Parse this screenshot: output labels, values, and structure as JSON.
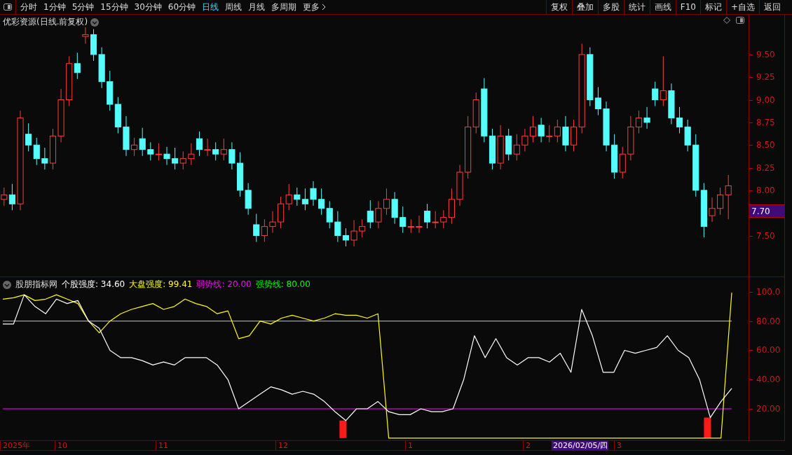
{
  "periods": [
    {
      "label": "分时",
      "selected": false
    },
    {
      "label": "1分钟",
      "selected": false
    },
    {
      "label": "5分钟",
      "selected": false
    },
    {
      "label": "15分钟",
      "selected": false
    },
    {
      "label": "30分钟",
      "selected": false
    },
    {
      "label": "60分钟",
      "selected": false
    },
    {
      "label": "日线",
      "selected": true
    },
    {
      "label": "周线",
      "selected": false
    },
    {
      "label": "月线",
      "selected": false
    },
    {
      "label": "多周期",
      "selected": false
    },
    {
      "label": "更多",
      "selected": false
    }
  ],
  "toolbar_buttons": [
    "复权",
    "叠加",
    "多股",
    "统计",
    "画线",
    "F10",
    "标记",
    "+自选",
    "返回"
  ],
  "price_panel": {
    "title": "优彩资源(日线.前复权)",
    "current_price": "7.70",
    "chart_data": {
      "type": "candlestick",
      "ylim": [
        7.04,
        9.94
      ],
      "yticks": [
        {
          "value": 9.5,
          "label": "9.50"
        },
        {
          "value": 9.25,
          "label": "9.25"
        },
        {
          "value": 9.0,
          "label": "9.00"
        },
        {
          "value": 8.75,
          "label": "8.75"
        },
        {
          "value": 8.5,
          "label": "8.50"
        },
        {
          "value": 8.25,
          "label": "8.25"
        },
        {
          "value": 8.0,
          "label": "8.00"
        },
        {
          "value": 7.5,
          "label": "7.50"
        }
      ],
      "ohlc": [
        [
          7.9,
          8.03,
          7.83,
          7.95
        ],
        [
          7.95,
          8.07,
          7.78,
          7.85
        ],
        [
          7.85,
          8.88,
          7.78,
          8.8
        ],
        [
          8.62,
          8.74,
          8.43,
          8.5
        ],
        [
          8.5,
          8.58,
          8.28,
          8.35
        ],
        [
          8.35,
          8.47,
          8.23,
          8.3
        ],
        [
          8.3,
          8.68,
          8.23,
          8.6
        ],
        [
          8.6,
          9.12,
          8.53,
          9.0
        ],
        [
          9.0,
          9.48,
          8.93,
          9.4
        ],
        [
          9.4,
          9.52,
          9.23,
          9.3
        ],
        [
          9.7,
          9.8,
          9.62,
          9.72
        ],
        [
          9.72,
          9.78,
          9.43,
          9.5
        ],
        [
          9.5,
          9.58,
          9.13,
          9.2
        ],
        [
          9.2,
          9.32,
          8.88,
          8.95
        ],
        [
          8.95,
          9.03,
          8.63,
          8.7
        ],
        [
          8.7,
          8.82,
          8.38,
          8.45
        ],
        [
          8.45,
          8.58,
          8.38,
          8.5
        ],
        [
          8.57,
          8.69,
          8.38,
          8.45
        ],
        [
          8.45,
          8.53,
          8.33,
          8.4
        ],
        [
          8.4,
          8.52,
          8.33,
          8.4
        ],
        [
          8.4,
          8.48,
          8.28,
          8.35
        ],
        [
          8.35,
          8.47,
          8.23,
          8.3
        ],
        [
          8.3,
          8.43,
          8.23,
          8.35
        ],
        [
          8.35,
          8.52,
          8.28,
          8.4
        ],
        [
          8.57,
          8.65,
          8.38,
          8.45
        ],
        [
          8.45,
          8.57,
          8.38,
          8.45
        ],
        [
          8.45,
          8.53,
          8.33,
          8.4
        ],
        [
          8.4,
          8.57,
          8.33,
          8.45
        ],
        [
          8.45,
          8.53,
          8.23,
          8.3
        ],
        [
          8.3,
          8.42,
          7.93,
          8.0
        ],
        [
          8.0,
          8.08,
          7.73,
          7.8
        ],
        [
          7.62,
          7.74,
          7.43,
          7.5
        ],
        [
          7.5,
          7.68,
          7.43,
          7.6
        ],
        [
          7.6,
          7.77,
          7.53,
          7.65
        ],
        [
          7.65,
          7.93,
          7.58,
          7.85
        ],
        [
          7.85,
          8.07,
          7.78,
          7.95
        ],
        [
          7.95,
          8.03,
          7.83,
          7.9
        ],
        [
          7.9,
          8.02,
          7.78,
          7.85
        ],
        [
          8.02,
          8.1,
          7.83,
          7.9
        ],
        [
          7.9,
          8.02,
          7.73,
          7.8
        ],
        [
          7.8,
          7.88,
          7.58,
          7.65
        ],
        [
          7.65,
          7.77,
          7.43,
          7.5
        ],
        [
          7.5,
          7.58,
          7.38,
          7.45
        ],
        [
          7.45,
          7.67,
          7.38,
          7.55
        ],
        [
          7.55,
          7.68,
          7.48,
          7.6
        ],
        [
          7.77,
          7.89,
          7.58,
          7.65
        ],
        [
          7.65,
          7.88,
          7.58,
          7.8
        ],
        [
          7.8,
          8.02,
          7.73,
          7.9
        ],
        [
          7.9,
          7.98,
          7.63,
          7.7
        ],
        [
          7.7,
          7.82,
          7.53,
          7.6
        ],
        [
          7.6,
          7.68,
          7.53,
          7.6
        ],
        [
          7.6,
          7.72,
          7.53,
          7.6
        ],
        [
          7.77,
          7.85,
          7.58,
          7.65
        ],
        [
          7.65,
          7.77,
          7.58,
          7.65
        ],
        [
          7.65,
          7.78,
          7.58,
          7.7
        ],
        [
          7.7,
          8.02,
          7.63,
          7.9
        ],
        [
          7.9,
          8.28,
          7.83,
          8.2
        ],
        [
          8.2,
          8.82,
          8.13,
          8.7
        ],
        [
          8.7,
          9.08,
          8.63,
          9.0
        ],
        [
          9.12,
          9.24,
          8.53,
          8.6
        ],
        [
          8.6,
          8.68,
          8.23,
          8.3
        ],
        [
          8.3,
          8.72,
          8.23,
          8.6
        ],
        [
          8.6,
          8.68,
          8.33,
          8.4
        ],
        [
          8.4,
          8.62,
          8.33,
          8.5
        ],
        [
          8.5,
          8.68,
          8.43,
          8.6
        ],
        [
          8.6,
          8.82,
          8.53,
          8.7
        ],
        [
          8.72,
          8.8,
          8.53,
          8.6
        ],
        [
          8.6,
          8.72,
          8.53,
          8.6
        ],
        [
          8.6,
          8.78,
          8.53,
          8.7
        ],
        [
          8.7,
          8.82,
          8.43,
          8.5
        ],
        [
          8.5,
          8.78,
          8.43,
          8.7
        ],
        [
          8.7,
          9.62,
          8.63,
          9.5
        ],
        [
          9.5,
          9.58,
          8.93,
          9.0
        ],
        [
          9.02,
          9.14,
          8.83,
          8.9
        ],
        [
          8.9,
          8.98,
          8.43,
          8.5
        ],
        [
          8.5,
          8.62,
          8.13,
          8.2
        ],
        [
          8.2,
          8.48,
          8.13,
          8.4
        ],
        [
          8.4,
          8.82,
          8.33,
          8.7
        ],
        [
          8.7,
          8.88,
          8.63,
          8.8
        ],
        [
          8.8,
          8.92,
          8.68,
          8.75
        ],
        [
          9.12,
          9.2,
          8.93,
          9.0
        ],
        [
          9.0,
          9.48,
          8.93,
          9.1
        ],
        [
          9.1,
          9.18,
          8.73,
          8.8
        ],
        [
          8.8,
          8.92,
          8.63,
          8.7
        ],
        [
          8.7,
          8.78,
          8.43,
          8.5
        ],
        [
          8.5,
          8.62,
          7.93,
          8.0
        ],
        [
          8.0,
          8.08,
          7.48,
          7.6
        ],
        [
          7.72,
          7.92,
          7.65,
          7.8
        ],
        [
          7.8,
          8.03,
          7.73,
          7.95
        ],
        [
          7.95,
          8.17,
          7.68,
          8.05
        ]
      ]
    }
  },
  "indicator_panel": {
    "title": "股朋指标网",
    "legend": [
      {
        "text": "个股强度: 34.60",
        "color": "#ffffff"
      },
      {
        "text": "大盘强度: 99.41",
        "color": "#ffff00"
      },
      {
        "text": "弱势线: 20.00",
        "color": "#ff00ff"
      },
      {
        "text": "强势线: 80.00",
        "color": "#00ff00"
      }
    ],
    "chart_data": {
      "type": "line",
      "ylim": [
        -2,
        110
      ],
      "yticks": [
        {
          "value": 100,
          "label": "100.0"
        },
        {
          "value": 80,
          "label": "80.00"
        },
        {
          "value": 60,
          "label": "60.00"
        },
        {
          "value": 40,
          "label": "40.00"
        },
        {
          "value": 20,
          "label": "20.00"
        }
      ],
      "series": [
        {
          "color": "#ffffff",
          "values": [
            78,
            78,
            98,
            90,
            85,
            95,
            92,
            94,
            80,
            75,
            60,
            55,
            55,
            53,
            50,
            52,
            50,
            55,
            55,
            55,
            50,
            40,
            20,
            25,
            30,
            35,
            33,
            30,
            32,
            30,
            25,
            18,
            12,
            20,
            20,
            25,
            18,
            16,
            16,
            20,
            18,
            18,
            20,
            40,
            70,
            55,
            68,
            55,
            50,
            55,
            55,
            52,
            58,
            45,
            88,
            70,
            45,
            45,
            60,
            58,
            60,
            62,
            70,
            60,
            55,
            40,
            14,
            25,
            34
          ]
        },
        {
          "color": "#ffff00",
          "values": [
            95,
            96,
            98,
            94,
            95,
            98,
            95,
            92,
            80,
            72,
            80,
            85,
            88,
            90,
            92,
            88,
            90,
            95,
            92,
            90,
            85,
            87,
            68,
            70,
            80,
            78,
            82,
            84,
            82,
            80,
            82,
            85,
            84,
            84,
            82,
            85,
            0,
            0,
            0,
            0,
            0,
            0,
            0,
            0,
            0,
            0,
            0,
            0,
            0,
            0,
            0,
            0,
            0,
            0,
            0,
            0,
            0,
            0,
            0,
            0,
            0,
            0,
            0,
            0,
            0,
            0,
            0,
            0,
            99.4
          ]
        },
        {
          "color": "#ff00ff",
          "values": [
            20,
            20,
            20,
            20,
            20,
            20,
            20,
            20,
            20,
            20,
            20,
            20,
            20,
            20,
            20,
            20,
            20,
            20,
            20,
            20,
            20,
            20,
            20,
            20,
            20,
            20,
            20,
            20,
            20,
            20,
            20,
            20,
            20,
            20,
            20,
            20,
            20,
            20,
            20,
            20,
            20,
            20,
            20,
            20,
            20,
            20,
            20,
            20,
            20,
            20,
            20,
            20,
            20,
            20,
            20,
            20,
            20,
            20,
            20,
            20,
            20,
            20,
            20,
            20,
            20,
            20,
            20,
            20,
            20
          ]
        },
        {
          "color": "#a0a0a0",
          "values": [
            80,
            80,
            80,
            80,
            80,
            80,
            80,
            80,
            80,
            80,
            80,
            80,
            80,
            80,
            80,
            80,
            80,
            80,
            80,
            80,
            80,
            80,
            80,
            80,
            80,
            80,
            80,
            80,
            80,
            80,
            80,
            80,
            80,
            80,
            80,
            80,
            80,
            80,
            80,
            80,
            80,
            80,
            80,
            80,
            80,
            80,
            80,
            80,
            80,
            80,
            80,
            80,
            80,
            80,
            80,
            80,
            80,
            80,
            80,
            80,
            80,
            80,
            80,
            80,
            80,
            80,
            80,
            80,
            80
          ]
        }
      ]
    }
  },
  "date_axis": [
    {
      "label": "2025年",
      "selected": false
    },
    {
      "label": "10",
      "selected": false
    },
    {
      "label": "11",
      "selected": false
    },
    {
      "label": "12",
      "selected": false
    },
    {
      "label": "1",
      "selected": false
    },
    {
      "label": "2",
      "selected": false
    },
    {
      "label": "2026/02/05/四",
      "selected": true
    },
    {
      "label": "3",
      "selected": false
    }
  ]
}
